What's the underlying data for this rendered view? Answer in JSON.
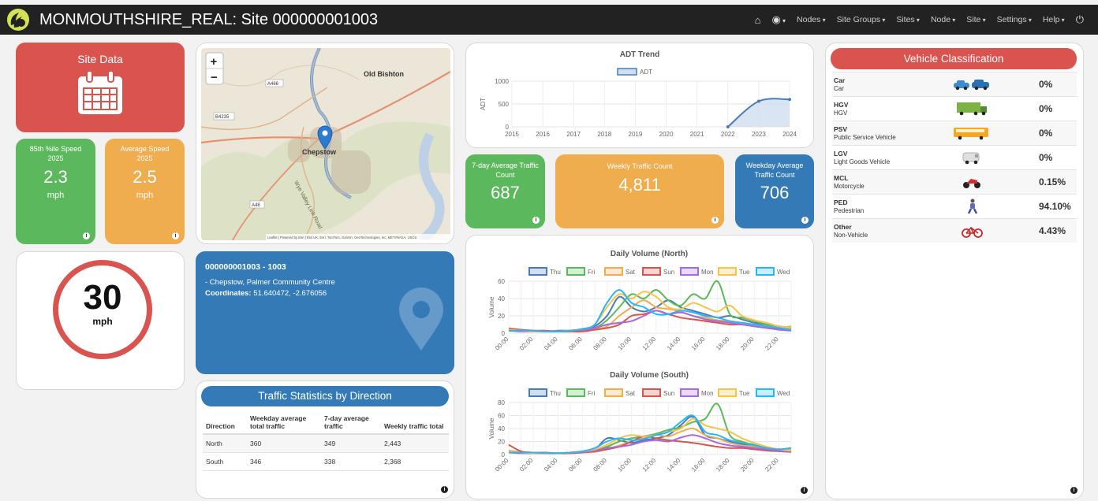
{
  "header": {
    "title": "MONMOUTHSHIRE_REAL: Site 000000001003",
    "nav": [
      "Nodes",
      "Site Groups",
      "Sites",
      "Node",
      "Site",
      "Settings",
      "Help"
    ]
  },
  "site_data": {
    "label": "Site Data"
  },
  "speed85": {
    "label": "85th %ile Speed",
    "year": "2025",
    "value": "2.3",
    "unit": "mph"
  },
  "avg_speed": {
    "label": "Average Speed",
    "year": "2025",
    "value": "2.5",
    "unit": "mph"
  },
  "speed_limit": {
    "value": "30",
    "unit": "mph"
  },
  "map": {
    "zoom_in": "+",
    "zoom_out": "−",
    "labels": {
      "old_bishton": "Old Bishton",
      "chepstow": "Chepstow",
      "a466": "A466",
      "b4235": "B4235",
      "a48": "A48",
      "wye": "Wye Valley Link Road"
    },
    "attribution": "Leaflet | Powered by Esri | Esri UK, Esri, TomTom, Garmin, GeoTechnologies, Inc, METI/NASA, USGS"
  },
  "site_info": {
    "id_line": "000000001003 - 1003",
    "location": "- Chepstow, Palmer Community Centre",
    "coords_label": "Coordinates:",
    "coords": "51.640472, -2.676056"
  },
  "stats_by_direction": {
    "title": "Traffic Statistics by Direction",
    "headers": [
      "Direction",
      "Weekday average total traffic",
      "7-day average traffic",
      "Weekly traffic total"
    ],
    "rows": [
      [
        "North",
        "360",
        "349",
        "2,443"
      ],
      [
        "South",
        "346",
        "338",
        "2,368"
      ]
    ]
  },
  "counts": {
    "seven_day": {
      "label": "7-day Average Traffic Count",
      "value": "687"
    },
    "weekly": {
      "label": "Weekly Traffic Count",
      "value": "4,811"
    },
    "weekday": {
      "label": "Weekday Average Traffic Count",
      "value": "706"
    }
  },
  "vehicle_classification": {
    "title": "Vehicle Classification",
    "rows": [
      {
        "code": "Car",
        "name": "Car",
        "pct": "0%",
        "icon": "car-icon"
      },
      {
        "code": "HGV",
        "name": "HGV",
        "pct": "0%",
        "icon": "truck-icon"
      },
      {
        "code": "PSV",
        "name": "Public Service Vehicle",
        "pct": "0%",
        "icon": "bus-icon"
      },
      {
        "code": "LGV",
        "name": "Light Goods Vehicle",
        "pct": "0%",
        "icon": "van-icon"
      },
      {
        "code": "MCL",
        "name": "Motorcycle",
        "pct": "0.15%",
        "icon": "motorcycle-icon"
      },
      {
        "code": "PED",
        "name": "Pedestrian",
        "pct": "94.10%",
        "icon": "pedestrian-icon"
      },
      {
        "code": "Other",
        "name": "Non-Vehicle",
        "pct": "4.43%",
        "icon": "bicycle-icon"
      }
    ]
  },
  "colors": {
    "thu": "#4a7bb7",
    "fri": "#5cb85c",
    "sat": "#f0ad4e",
    "sun": "#d9534f",
    "mon": "#a66ae0",
    "tue": "#f7c34a",
    "wed": "#29b6f6"
  },
  "chart_data": [
    {
      "type": "area",
      "title": "ADT Trend",
      "legend": [
        "ADT"
      ],
      "ylabel": "ADT",
      "categories": [
        "2015",
        "2016",
        "2017",
        "2018",
        "2019",
        "2020",
        "2021",
        "2022",
        "2023",
        "2024"
      ],
      "yticks": [
        "0",
        "500",
        "1000"
      ],
      "ylim": [
        0,
        1000
      ],
      "values": [
        null,
        null,
        null,
        null,
        null,
        null,
        null,
        0,
        560,
        600
      ]
    },
    {
      "type": "line",
      "title": "Daily Volume (North)",
      "ylabel": "Volume",
      "ylim": [
        0,
        60
      ],
      "yticks": [
        "0",
        "20",
        "40",
        "60"
      ],
      "xticks": [
        "00:00",
        "02:00",
        "04:00",
        "06:00",
        "08:00",
        "10:00",
        "12:00",
        "14:00",
        "16:00",
        "18:00",
        "20:00",
        "22:00"
      ],
      "series": [
        {
          "name": "Thu",
          "values": [
            5,
            3,
            3,
            2,
            3,
            3,
            4,
            8,
            20,
            42,
            30,
            25,
            30,
            38,
            30,
            26,
            22,
            18,
            20,
            16,
            12,
            10,
            8,
            6
          ]
        },
        {
          "name": "Fri",
          "values": [
            4,
            3,
            2,
            2,
            2,
            3,
            4,
            6,
            15,
            30,
            45,
            40,
            50,
            38,
            32,
            45,
            40,
            60,
            22,
            18,
            14,
            10,
            8,
            5
          ]
        },
        {
          "name": "Sat",
          "values": [
            6,
            4,
            3,
            2,
            2,
            2,
            3,
            5,
            8,
            20,
            30,
            38,
            30,
            28,
            25,
            20,
            18,
            15,
            14,
            12,
            10,
            8,
            6,
            8
          ]
        },
        {
          "name": "Sun",
          "values": [
            5,
            4,
            3,
            3,
            2,
            2,
            2,
            4,
            6,
            10,
            20,
            22,
            26,
            22,
            18,
            16,
            14,
            12,
            10,
            10,
            8,
            6,
            5,
            4
          ]
        },
        {
          "name": "Mon",
          "values": [
            3,
            2,
            2,
            2,
            2,
            3,
            4,
            6,
            10,
            12,
            14,
            20,
            26,
            22,
            24,
            20,
            16,
            14,
            12,
            10,
            8,
            6,
            4,
            3
          ]
        },
        {
          "name": "Tue",
          "values": [
            4,
            3,
            2,
            2,
            2,
            3,
            5,
            10,
            30,
            45,
            40,
            48,
            42,
            30,
            28,
            35,
            30,
            25,
            32,
            20,
            15,
            12,
            8,
            6
          ]
        },
        {
          "name": "Wed",
          "values": [
            3,
            3,
            3,
            2,
            2,
            3,
            5,
            10,
            35,
            50,
            35,
            30,
            22,
            22,
            26,
            24,
            20,
            18,
            14,
            12,
            10,
            8,
            6,
            4
          ]
        }
      ]
    },
    {
      "type": "line",
      "title": "Daily Volume (South)",
      "ylabel": "Volume",
      "ylim": [
        0,
        80
      ],
      "yticks": [
        "0",
        "20",
        "40",
        "60",
        "80"
      ],
      "xticks": [
        "00:00",
        "02:00",
        "04:00",
        "06:00",
        "08:00",
        "10:00",
        "12:00",
        "14:00",
        "16:00",
        "18:00",
        "20:00",
        "22:00"
      ],
      "series": [
        {
          "name": "Thu",
          "values": [
            5,
            3,
            3,
            2,
            2,
            3,
            4,
            8,
            25,
            22,
            18,
            22,
            25,
            30,
            45,
            58,
            30,
            25,
            20,
            16,
            12,
            10,
            8,
            6
          ]
        },
        {
          "name": "Fri",
          "values": [
            4,
            3,
            2,
            2,
            2,
            3,
            4,
            6,
            12,
            20,
            25,
            28,
            32,
            38,
            42,
            50,
            55,
            78,
            30,
            20,
            15,
            10,
            8,
            5
          ]
        },
        {
          "name": "Sat",
          "values": [
            6,
            4,
            3,
            2,
            2,
            2,
            3,
            4,
            8,
            14,
            20,
            25,
            30,
            28,
            35,
            40,
            30,
            25,
            18,
            14,
            12,
            8,
            6,
            8
          ]
        },
        {
          "name": "Sun",
          "values": [
            15,
            5,
            3,
            3,
            2,
            2,
            3,
            5,
            8,
            12,
            20,
            28,
            25,
            22,
            20,
            18,
            15,
            12,
            10,
            10,
            8,
            6,
            5,
            4
          ]
        },
        {
          "name": "Mon",
          "values": [
            3,
            2,
            2,
            2,
            2,
            3,
            4,
            6,
            10,
            12,
            15,
            20,
            22,
            20,
            26,
            30,
            25,
            18,
            14,
            12,
            10,
            8,
            6,
            4
          ]
        },
        {
          "name": "Tue",
          "values": [
            4,
            3,
            2,
            2,
            2,
            3,
            5,
            8,
            15,
            25,
            30,
            28,
            30,
            35,
            40,
            55,
            45,
            40,
            35,
            25,
            18,
            12,
            8,
            6
          ]
        },
        {
          "name": "Wed",
          "values": [
            3,
            3,
            3,
            2,
            2,
            3,
            5,
            10,
            20,
            25,
            22,
            24,
            30,
            35,
            50,
            60,
            35,
            30,
            22,
            18,
            14,
            10,
            8,
            10
          ]
        }
      ]
    }
  ]
}
